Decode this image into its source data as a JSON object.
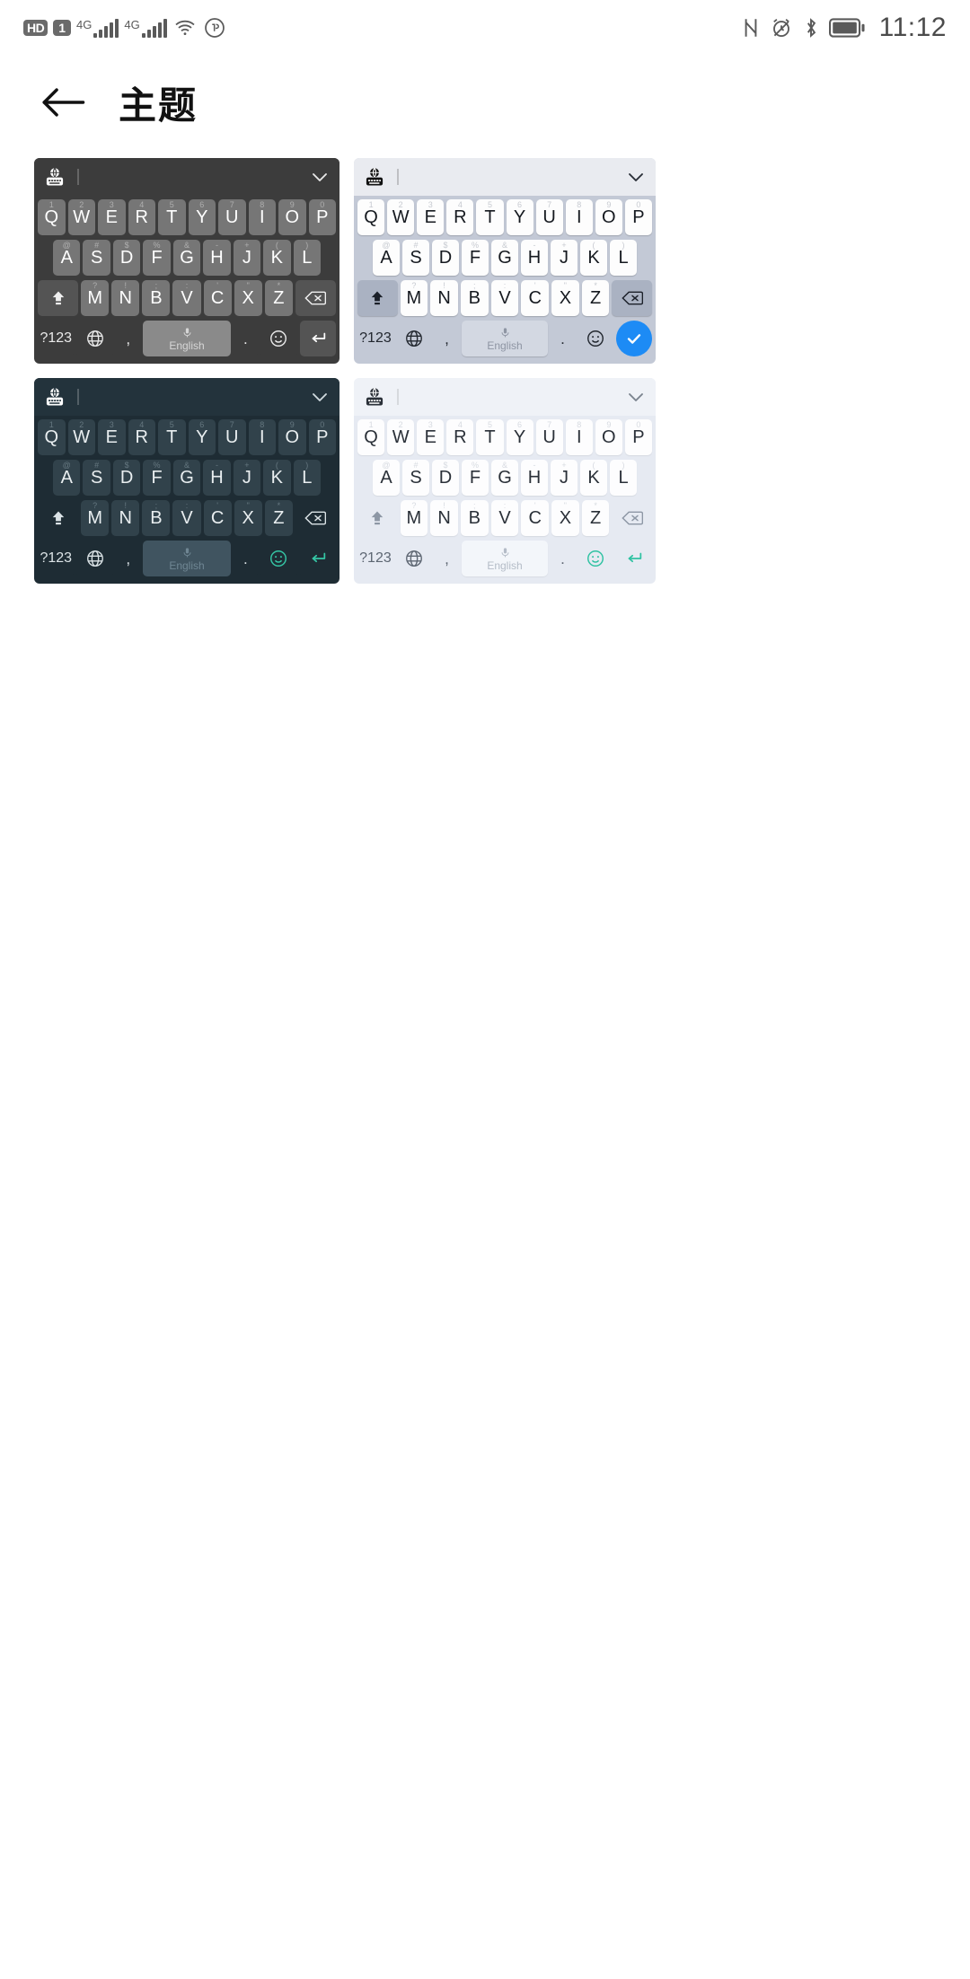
{
  "statusbar": {
    "icons_left": [
      "hd-volte-icon",
      "sim1-icon",
      "signal-4g-1-icon",
      "signal-4g-2-icon",
      "wifi-icon",
      "data-saver-icon"
    ],
    "hd_label": "HD",
    "sim_label": "1",
    "network_label_1": "4G",
    "network_label_2": "4G",
    "icons_right": [
      "nfc-icon",
      "alarm-mute-icon",
      "bluetooth-icon",
      "battery-icon"
    ],
    "clock": "11:12"
  },
  "header": {
    "back_icon": "back-arrow-icon",
    "title": "主题"
  },
  "keyboard_common": {
    "toolbar_icon": "language-keyboard-icon",
    "collapse_icon": "chevron-down-icon",
    "row1": [
      {
        "letter": "Q",
        "sup": "1"
      },
      {
        "letter": "W",
        "sup": "2"
      },
      {
        "letter": "E",
        "sup": "3"
      },
      {
        "letter": "R",
        "sup": "4"
      },
      {
        "letter": "T",
        "sup": "5"
      },
      {
        "letter": "Y",
        "sup": "6"
      },
      {
        "letter": "U",
        "sup": "7"
      },
      {
        "letter": "I",
        "sup": "8"
      },
      {
        "letter": "O",
        "sup": "9"
      },
      {
        "letter": "P",
        "sup": "0"
      }
    ],
    "row2": [
      {
        "letter": "A",
        "sup": "@"
      },
      {
        "letter": "S",
        "sup": "#"
      },
      {
        "letter": "D",
        "sup": "$"
      },
      {
        "letter": "F",
        "sup": "%"
      },
      {
        "letter": "G",
        "sup": "&"
      },
      {
        "letter": "H",
        "sup": "-"
      },
      {
        "letter": "J",
        "sup": "+"
      },
      {
        "letter": "K",
        "sup": "("
      },
      {
        "letter": "L",
        "sup": ")"
      }
    ],
    "row3": [
      {
        "letter": "Z",
        "sup": "*"
      },
      {
        "letter": "X",
        "sup": "\""
      },
      {
        "letter": "C",
        "sup": "'"
      },
      {
        "letter": "V",
        "sup": ":"
      },
      {
        "letter": "B",
        "sup": ";"
      },
      {
        "letter": "N",
        "sup": "!"
      },
      {
        "letter": "M",
        "sup": "?"
      }
    ],
    "shift_icon": "shift-icon",
    "backspace_icon": "backspace-icon",
    "symbols_label": "?123",
    "globe_icon": "globe-icon",
    "comma_label": ",",
    "space_label": "English",
    "mic_icon": "microphone-icon",
    "period_label": ".",
    "emoji_icon": "emoji-smiley-icon",
    "enter_icon": "enter-icon"
  },
  "themes": [
    {
      "id": "theme-dark-gray",
      "name": "dark-gray-theme",
      "background": "#3c3c3c",
      "key_color": "#767676",
      "text_color": "#ffffff",
      "accent": "#545454",
      "enter_glyph": "enter-arrow-icon"
    },
    {
      "id": "theme-light-blue-gray",
      "name": "light-blue-gray-theme",
      "background": "#c3c9d6",
      "key_color": "#fdfdfd",
      "text_color": "#15191f",
      "accent": "#1d8bf5",
      "enter_glyph": "check-icon"
    },
    {
      "id": "theme-dark-navy",
      "name": "dark-navy-theme",
      "background": "#1e2c34",
      "key_color": "#31424b",
      "text_color": "#e9eef0",
      "accent": "#35c6a5",
      "enter_glyph": "enter-arrow-icon"
    },
    {
      "id": "theme-pale-blue",
      "name": "pale-blue-theme",
      "background": "#e6eaf2",
      "key_color": "#fdfdfe",
      "text_color": "#2a3038",
      "accent": "#2fc2a2",
      "enter_glyph": "enter-arrow-icon"
    }
  ]
}
